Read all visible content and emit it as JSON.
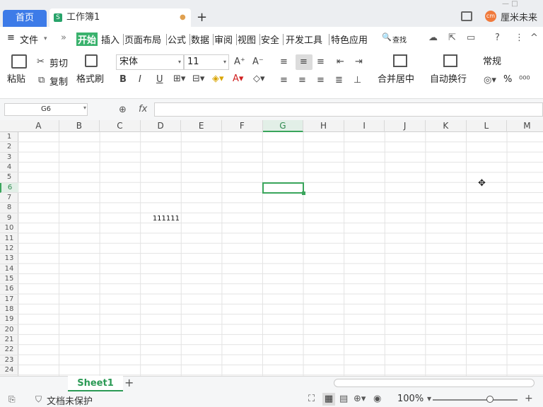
{
  "tabs": {
    "home": "首页",
    "doc": "工作簿1",
    "add": "+"
  },
  "window": {
    "controls": "— □",
    "user_name": "厘米未来",
    "avatar": "cm"
  },
  "menu": {
    "file": "文件",
    "items": [
      "开始",
      "插入",
      "页面布局",
      "公式",
      "数据",
      "审阅",
      "视图",
      "安全",
      "开发工具",
      "特色应用"
    ],
    "search": "查找"
  },
  "ribbon": {
    "paste": "粘贴",
    "cut": "剪切",
    "copy": "复制",
    "format_painter": "格式刷",
    "font_name": "宋体",
    "font_size": "11",
    "merge_center": "合并居中",
    "wrap_text": "自动换行",
    "number_format": "常规",
    "percent": "%"
  },
  "formula_bar": {
    "cell_ref": "G6",
    "fx": "fx",
    "value": ""
  },
  "grid": {
    "columns": [
      "A",
      "B",
      "C",
      "D",
      "E",
      "F",
      "G",
      "H",
      "I",
      "J",
      "K",
      "L",
      "M"
    ],
    "rows": [
      "1",
      "2",
      "3",
      "4",
      "5",
      "6",
      "7",
      "8",
      "9",
      "10",
      "11",
      "12",
      "13",
      "14",
      "15",
      "16",
      "17",
      "18",
      "19",
      "20",
      "21",
      "22",
      "23",
      "24"
    ],
    "active_column": "G",
    "active_row": "6",
    "cell_values": {
      "D9": "111111"
    }
  },
  "sheets": {
    "active": "Sheet1",
    "add": "+"
  },
  "status": {
    "protect": "文档未保护",
    "zoom": "100%"
  },
  "colors": {
    "accent_green": "#3aa55c",
    "home_tab_blue": "#3d7be8"
  }
}
